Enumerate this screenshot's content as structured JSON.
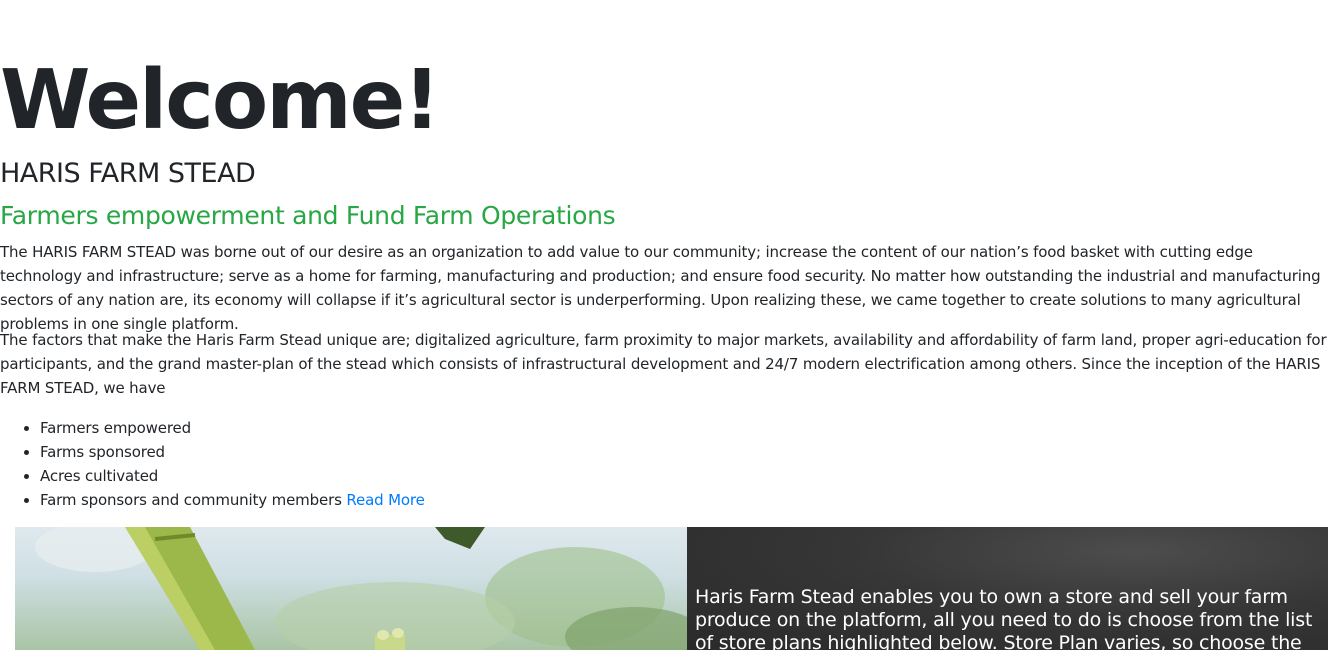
{
  "hero": {
    "heading": "Welcome!",
    "org_name": "HARIS FARM STEAD",
    "tagline": "Farmers empowerment and Fund Farm Operations"
  },
  "about": {
    "paragraph_1": "The HARIS FARM STEAD was borne out of our desire as an organization to add value to our community; increase the content of our nation’s food basket with cutting edge technology and infrastructure; serve as a home for farming, manufacturing and production; and ensure food security. No matter how outstanding the industrial and manufacturing sectors of any nation are, its economy will collapse if it’s agricultural sector is underperforming. Upon realizing these, we came together to create solutions to many agricultural problems in one single platform.",
    "paragraph_2": "The factors that make the Haris Farm Stead unique are; digitalized agriculture, farm proximity to major markets, availability and affordability of farm land, proper agri-education for participants, and the grand master-plan of the stead which consists of infrastructural development and 24/7 modern electrification among others. Since the inception of the HARIS FARM STEAD, we have"
  },
  "stats": {
    "items": [
      "Farmers empowered",
      "Farms sponsored",
      "Acres cultivated",
      "Farm sponsors and community members"
    ],
    "read_more_label": "Read More"
  },
  "store_banner": {
    "text": "Haris Farm Stead enables you to own a store and sell your farm produce on the platform, all you need to do is choose from the list of store plans highlighted below. Store Plan varies, so choose the one that"
  },
  "colors": {
    "tagline": "#28a745",
    "link": "#007bff",
    "text": "#212529",
    "panel_bg": "#363636"
  }
}
